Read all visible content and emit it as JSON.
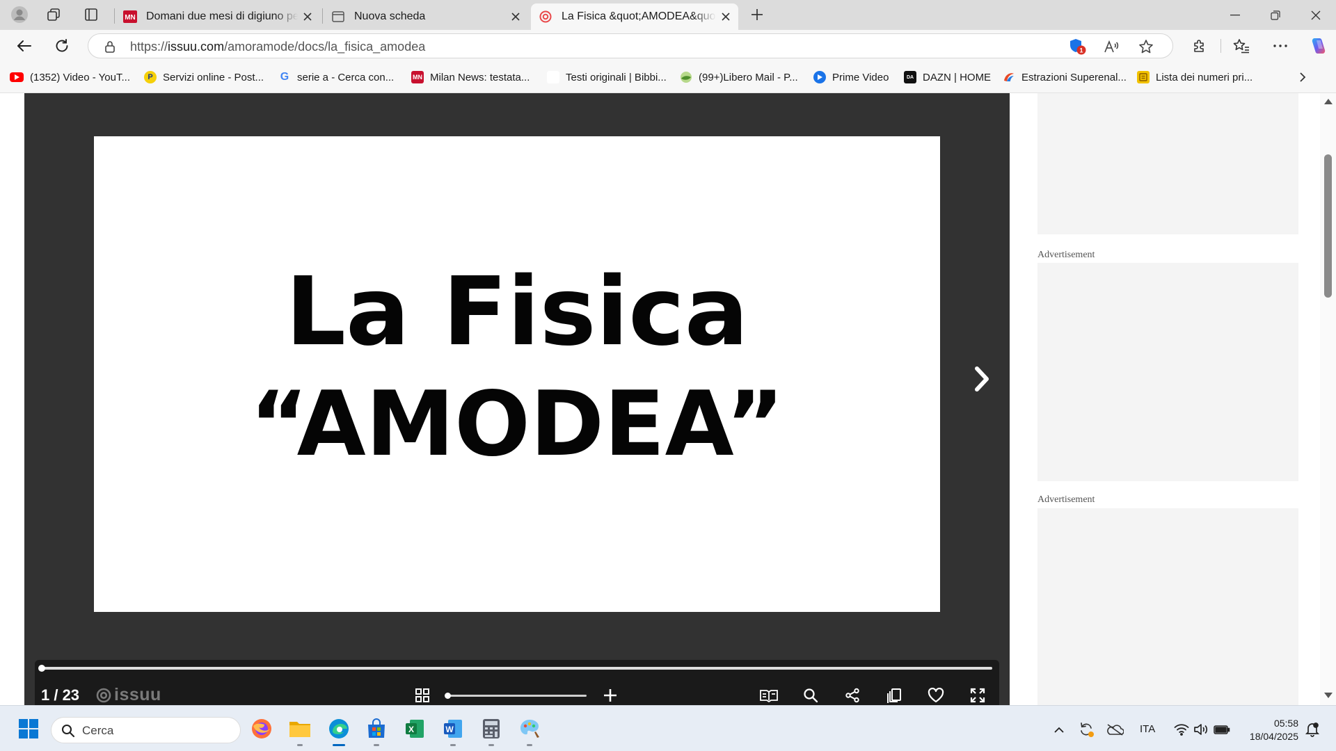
{
  "tabs": [
    {
      "title": "Domani due mesi di digiuno per C",
      "favicon": "mn-logo-icon",
      "active": false
    },
    {
      "title": "Nuova scheda",
      "favicon": "new-tab-page-icon",
      "active": false
    },
    {
      "title": "La Fisica &quot;AMODEA&quot; by",
      "favicon": "issuu-icon",
      "active": true
    }
  ],
  "address": {
    "scheme": "https://",
    "host": "issuu.com",
    "path": "/amoramode/docs/la_fisica_amodea",
    "badge_count": "1"
  },
  "bookmarks": [
    {
      "label": "(1352) Video - YouT...",
      "icon": "youtube-icon",
      "color": "#ff0000"
    },
    {
      "label": "Servizi online - Post...",
      "icon": "poste-icon",
      "color": "#f5d00a"
    },
    {
      "label": "serie a - Cerca con...",
      "icon": "google-icon",
      "color": "#4285f4"
    },
    {
      "label": "Milan News: testata...",
      "icon": "mn-logo-icon",
      "color": "#c8102e"
    },
    {
      "label": "Testi originali | Bibbi...",
      "icon": "blank-page-icon",
      "color": "#ffffff"
    },
    {
      "label": "(99+)Libero Mail - P...",
      "icon": "libero-icon",
      "color": "#6aa84f"
    },
    {
      "label": "Prime Video",
      "icon": "prime-video-icon",
      "color": "#1a73e8"
    },
    {
      "label": "DAZN | HOME",
      "icon": "dazn-icon",
      "color": "#111111"
    },
    {
      "label": "Estrazioni Superenal...",
      "icon": "superenalotto-icon",
      "color": "#e84a27"
    },
    {
      "label": "Lista dei numeri pri...",
      "icon": "list-icon",
      "color": "#f2c200"
    }
  ],
  "document": {
    "title_line1": "La Fisica",
    "title_line2": "“AMODEA”",
    "page_count": "1 / 23",
    "brand": "issuu",
    "progress_fraction": 0.0,
    "zoom_fraction": 0.0
  },
  "sidebar": {
    "ad_label": "Advertisement"
  },
  "taskbar": {
    "search_placeholder": "Cerca",
    "language": "ITA",
    "time": "05:58",
    "date": "18/04/2025"
  },
  "colors": {
    "viewer_bg": "#323232",
    "control_bar": "#1a1a1a",
    "accent": "#0067c0"
  }
}
